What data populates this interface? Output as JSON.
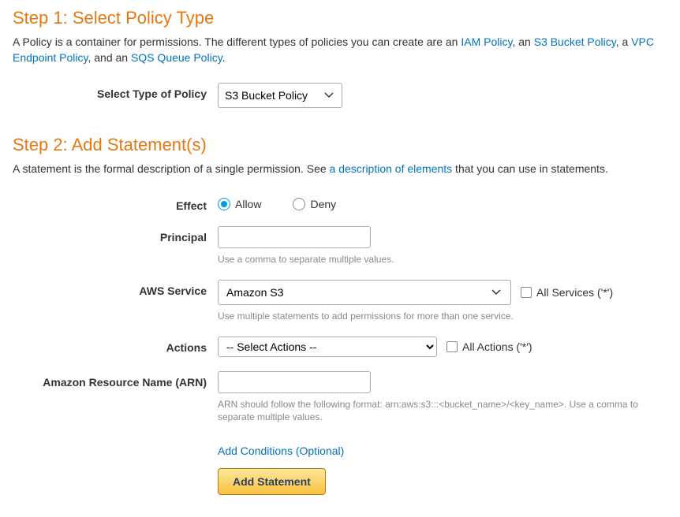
{
  "step1": {
    "title": "Step 1: Select Policy Type",
    "desc_pre": "A Policy is a container for permissions. The different types of policies you can create are an ",
    "link_iam": "IAM Policy",
    "desc_mid1": ", an ",
    "link_s3": "S3 Bucket Policy",
    "desc_mid2": ", a ",
    "link_vpc": "VPC Endpoint Policy",
    "desc_mid3": ", and an ",
    "link_sqs": "SQS Queue Policy",
    "desc_end": ".",
    "label_select_type": "Select Type of Policy",
    "policy_type_value": "S3 Bucket Policy"
  },
  "step2": {
    "title": "Step 2: Add Statement(s)",
    "desc_pre": "A statement is the formal description of a single permission. See ",
    "link_elements": "a description of elements",
    "desc_end": " that you can use in statements.",
    "labels": {
      "effect": "Effect",
      "principal": "Principal",
      "aws_service": "AWS Service",
      "actions": "Actions",
      "arn": "Amazon Resource Name (ARN)"
    },
    "effect": {
      "allow_label": "Allow",
      "deny_label": "Deny",
      "selected": "allow"
    },
    "principal": {
      "value": "",
      "hint": "Use a comma to separate multiple values."
    },
    "aws_service": {
      "value": "Amazon S3",
      "all_services_label": "All Services ('*')",
      "hint": "Use multiple statements to add permissions for more than one service."
    },
    "actions": {
      "value": "-- Select Actions --",
      "all_actions_label": "All Actions ('*')"
    },
    "arn": {
      "value": "",
      "hint": "ARN should follow the following format: arn:aws:s3:::<bucket_name>/<key_name>. Use a comma to separate multiple values."
    },
    "conditions_link": "Add Conditions (Optional)",
    "add_statement_button": "Add Statement"
  }
}
